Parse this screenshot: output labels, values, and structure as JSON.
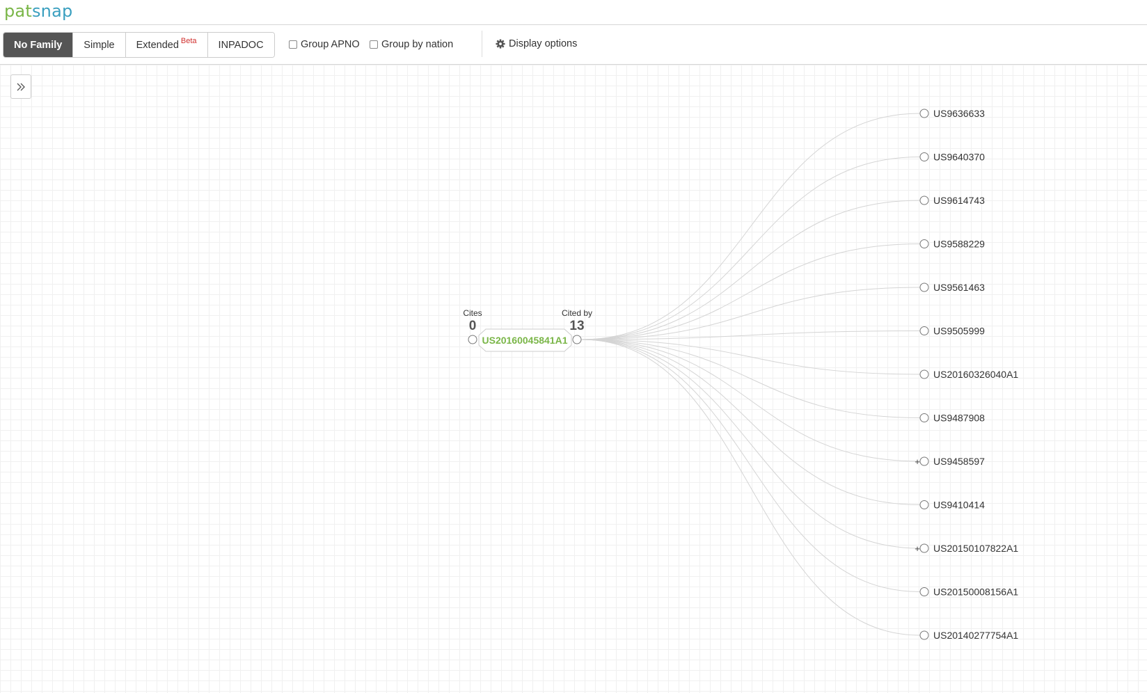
{
  "header": {
    "logo_part1": "pat",
    "logo_part2": "snap"
  },
  "toolbar": {
    "family_modes": [
      {
        "label": "No Family",
        "active": true
      },
      {
        "label": "Simple",
        "active": false
      },
      {
        "label": "Extended",
        "badge": "Beta",
        "active": false
      },
      {
        "label": "INPADOC",
        "active": false
      }
    ],
    "group_apno_label": "Group APNO",
    "group_apno_checked": false,
    "group_nation_label": "Group by nation",
    "group_nation_checked": false,
    "display_options_label": "Display options",
    "display_options_icon": "gear-icon"
  },
  "sidebar_toggle_icon": "double-chevron-right-icon",
  "citation_graph": {
    "center": {
      "id": "US20160045841A1",
      "cites_label": "Cites",
      "cites_count": "0",
      "cited_by_label": "Cited by",
      "cited_by_count": "13",
      "color": "#7ab648"
    },
    "cited_by": [
      {
        "id": "US9636633",
        "expandable": false
      },
      {
        "id": "US9640370",
        "expandable": false
      },
      {
        "id": "US9614743",
        "expandable": false
      },
      {
        "id": "US9588229",
        "expandable": false
      },
      {
        "id": "US9561463",
        "expandable": false
      },
      {
        "id": "US9505999",
        "expandable": false
      },
      {
        "id": "US20160326040A1",
        "expandable": false
      },
      {
        "id": "US9487908",
        "expandable": false
      },
      {
        "id": "US9458597",
        "expandable": true
      },
      {
        "id": "US9410414",
        "expandable": false
      },
      {
        "id": "US20150107822A1",
        "expandable": true
      },
      {
        "id": "US20150008156A1",
        "expandable": false
      },
      {
        "id": "US20140277754A1",
        "expandable": false
      }
    ],
    "link_color": "#d4d4d4",
    "node_stroke": "#777777",
    "expand_symbol": "+"
  }
}
